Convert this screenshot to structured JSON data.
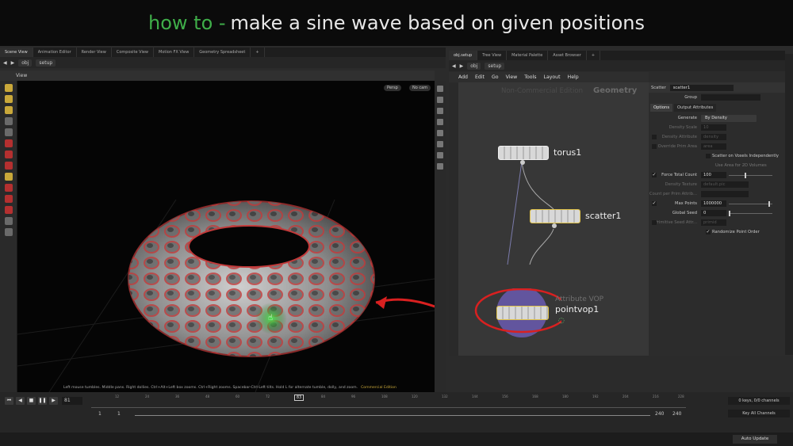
{
  "title": {
    "prefix": "how to -",
    "main": "make a sine wave based on given positions"
  },
  "left_tabs": [
    "Scene View",
    "Animation Editor",
    "Render View",
    "Composite View",
    "Motion FX View",
    "Geometry Spreadsheet"
  ],
  "right_tabs": [
    "obj.setup",
    "Tree View",
    "Material Palette",
    "Asset Browser"
  ],
  "left_path": [
    "obj",
    "setup"
  ],
  "right_path": [
    "obj",
    "setup"
  ],
  "viewport": {
    "label": "View",
    "persp": "Persp",
    "cam": "No cam",
    "status": "Left mouse tumbles. Middle pans. Right dollies. Ctrl+Alt+Left box zooms. Ctrl+Right zooms. Spacebar-Ctrl-Left tilts. Hold L for alternate tumble, dolly, and zoom.",
    "edition": "Commercial Edition"
  },
  "menu": [
    "Add",
    "Edit",
    "Go",
    "View",
    "Tools",
    "Layout",
    "Help"
  ],
  "network": {
    "watermark": "Non-Commercial Edition",
    "context": "Geometry",
    "nodes": {
      "torus": "torus1",
      "scatter": "scatter1",
      "vop": "pointvop1",
      "vop_type": "Attribute VOP"
    }
  },
  "params": {
    "type": "Scatter",
    "name": "scatter1",
    "group_label": "Group",
    "tabs": [
      "Options",
      "Output Attributes"
    ],
    "generate_label": "Generate",
    "generate_value": "By Density",
    "density_scale_label": "Density Scale",
    "density_scale_value": "10",
    "density_attr_label": "Density Attribute",
    "density_attr_value": "density",
    "override_prim_label": "Override Prim Area",
    "override_prim_value": "area",
    "scatter_voxels": "Scatter on Voxels Independently",
    "use_area": "Use Area for 2D Volumes",
    "force_total_label": "Force Total Count",
    "force_total_value": "100",
    "density_texture_label": "Density Texture",
    "density_texture_value": "default.pic",
    "count_per_prim_label": "Count per Prim Attrib...",
    "max_points_label": "Max Points",
    "max_points_value": "1000000",
    "global_seed_label": "Global Seed",
    "global_seed_value": "0",
    "prim_seed_label": "Primitive Seed Attr...",
    "prim_seed_value": "primid",
    "randomize_label": "Randomize Point Order"
  },
  "timeline": {
    "frame": "81",
    "cursor": "83",
    "ticks": [
      "12",
      "24",
      "36",
      "48",
      "60",
      "72",
      "84",
      "96",
      "108",
      "120",
      "132",
      "144",
      "156",
      "168",
      "180",
      "192",
      "204",
      "216",
      "228"
    ],
    "start": "1",
    "start2": "1",
    "end": "240",
    "end2": "240",
    "keys": "0 keys, 0/0 channels",
    "channels": "Key All Channels",
    "auto_update": "Auto Update"
  }
}
